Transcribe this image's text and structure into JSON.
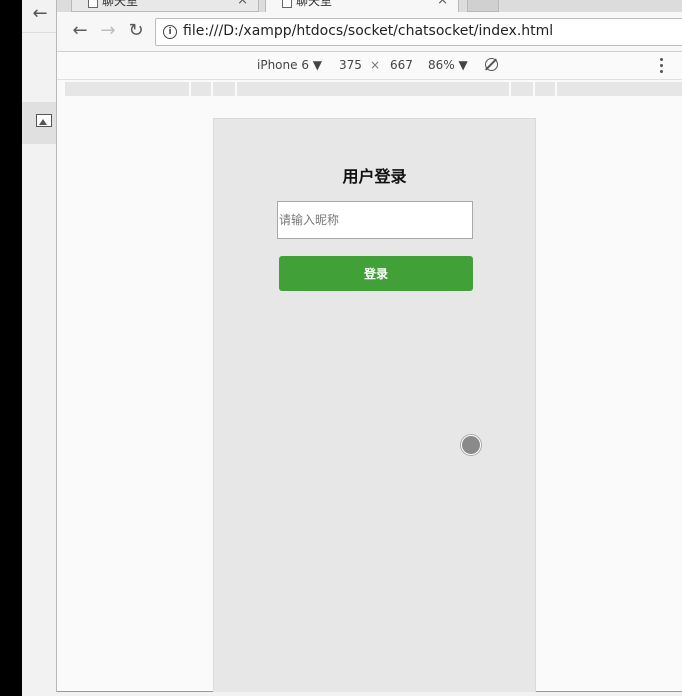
{
  "background_window": {
    "back_icon": "arrow-left-icon",
    "side_icon": "image-icon"
  },
  "browser": {
    "tabs": [
      {
        "title": "聊天室",
        "close": "×"
      },
      {
        "title": "聊天室",
        "close": "×"
      }
    ],
    "nav": {
      "back": "←",
      "forward": "→",
      "reload": "↻"
    },
    "address": {
      "info": "i",
      "url": "file:///D:/xampp/htdocs/socket/chatsocket/index.html"
    }
  },
  "devtools": {
    "device": "iPhone 6 ▼",
    "width": "375",
    "times": "×",
    "height": "667",
    "zoom": "86% ▼"
  },
  "page": {
    "title": "用户登录",
    "nickname_placeholder": "请输入昵称",
    "login_label": "登录"
  },
  "colors": {
    "login_button": "#42a038",
    "device_background": "#e6e7e6"
  }
}
